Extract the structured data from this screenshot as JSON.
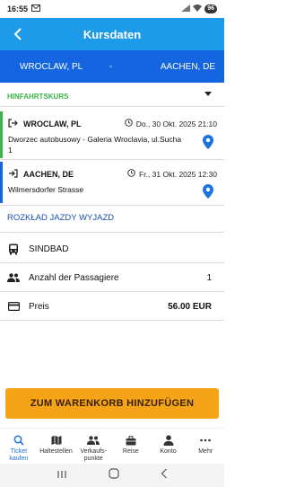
{
  "status": {
    "time": "16:55",
    "battery": "96"
  },
  "appbar": {
    "title": "Kursdaten"
  },
  "route": {
    "from": "WROCLAW, PL",
    "separator": "-",
    "to": "AACHEN, DE"
  },
  "section": {
    "label": "HINFAHRTSKURS"
  },
  "departure": {
    "city": "WROCLAW, PL",
    "datetime": "Do., 30 Okt. 2025 21:10",
    "address": "Dworzec autobusowy - Galeria Wroclavia, ul.Sucha 1"
  },
  "arrival": {
    "city": "AACHEN, DE",
    "datetime": "Fr., 31 Okt. 2025 12:30",
    "address": "Wilmersdorfer Strasse"
  },
  "schedule_link": "ROZKŁAD JAZDY WYJAZD",
  "carrier": {
    "name": "SINDBAD"
  },
  "passengers": {
    "label": "Anzahl der Passagiere",
    "value": "1"
  },
  "price": {
    "label": "Preis",
    "value": "56.00 EUR"
  },
  "cart_button": "ZUM WARENKORB HINZUFÜGEN",
  "nav": [
    {
      "label": "Ticket\nkaufen",
      "line1": "Ticket",
      "line2": "kaufen"
    },
    {
      "label": "Haltestellen"
    },
    {
      "line1": "Verkaufs-",
      "line2": "punkte"
    },
    {
      "label": "Reise"
    },
    {
      "label": "Konto"
    },
    {
      "label": "Mehr"
    }
  ],
  "colors": {
    "primary": "#1e9be8",
    "route_bar": "#1565e0",
    "accent_green": "#3bb54a",
    "button": "#f5a418",
    "pin": "#1e73d8"
  }
}
